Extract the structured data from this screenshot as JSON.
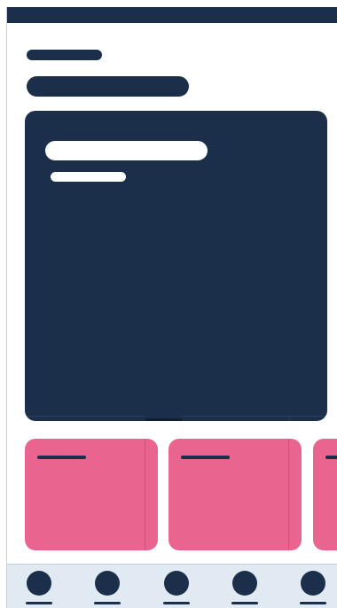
{
  "colors": {
    "primary": "#1b2f4a",
    "accent": "#e96590",
    "nav_background": "#e1e9f2",
    "surface": "#ffffff"
  },
  "header": {
    "placeholder_lines": [
      "short",
      "long"
    ]
  },
  "hero": {
    "placeholder_lines": [
      "title",
      "subtitle"
    ]
  },
  "tiles": [
    "tile-1",
    "tile-2",
    "tile-3"
  ],
  "bottom_nav": {
    "items": [
      "nav-item-1",
      "nav-item-2",
      "nav-item-3",
      "nav-item-4",
      "nav-item-5"
    ]
  }
}
